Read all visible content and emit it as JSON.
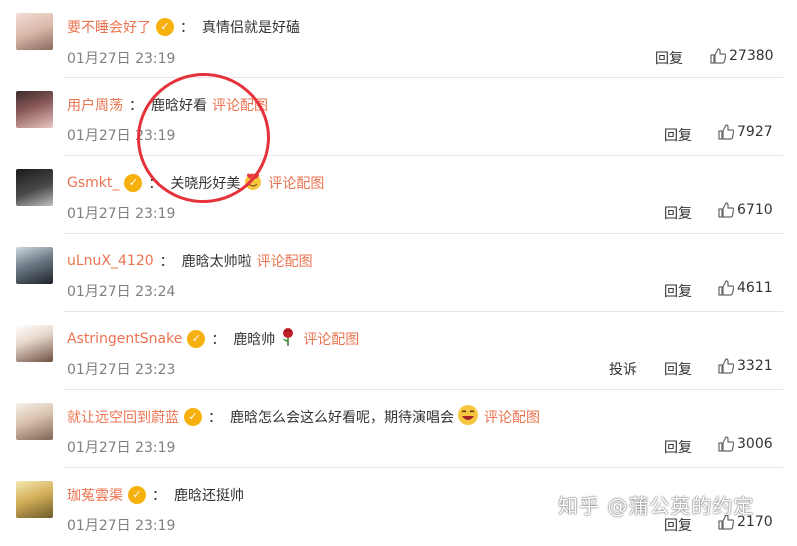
{
  "colors": {
    "username": "#eb7350",
    "pic_link": "#eb7350",
    "badge": "#f7b10f",
    "circle": "#e5323a"
  },
  "comments": [
    {
      "username": "要不睡会好了",
      "verified": true,
      "text": "真情侣就是好磕",
      "emoji": "",
      "pic_link": "",
      "time": "01月27日 23:19",
      "report": "",
      "reply": "回复",
      "likes": "27380"
    },
    {
      "username": "用户周荡",
      "verified": false,
      "text": "鹿晗好看",
      "emoji": "",
      "pic_link": "评论配图",
      "time": "01月27日 23:19",
      "report": "",
      "reply": "回复",
      "likes": "7927"
    },
    {
      "username": "Gsmkt_",
      "verified": true,
      "text": "关晓彤好美",
      "emoji": "heart-face-emoji",
      "pic_link": "评论配图",
      "time": "01月27日 23:19",
      "report": "",
      "reply": "回复",
      "likes": "6710"
    },
    {
      "username": "uLnuX_4120",
      "verified": false,
      "text": "鹿晗太帅啦",
      "emoji": "",
      "pic_link": "评论配图",
      "time": "01月27日 23:24",
      "report": "",
      "reply": "回复",
      "likes": "4611"
    },
    {
      "username": "AstringentSnake",
      "verified": true,
      "text": "鹿晗帅",
      "emoji": "rose-emoji",
      "pic_link": "评论配图",
      "time": "01月27日 23:23",
      "report": "投诉",
      "reply": "回复",
      "likes": "3321"
    },
    {
      "username": "就让远空回到蔚蓝",
      "verified": true,
      "text": "鹿晗怎么会这么好看呢，期待演唱会",
      "emoji": "laughing-emoji",
      "pic_link": "评论配图",
      "time": "01月27日 23:19",
      "report": "",
      "reply": "回复",
      "likes": "3006"
    },
    {
      "username": "珈菟雲渠",
      "verified": true,
      "text": "鹿晗还挺帅",
      "emoji": "",
      "pic_link": "",
      "time": "01月27日 23:19",
      "report": "",
      "reply": "回复",
      "likes": "2170"
    }
  ],
  "watermark": "知乎 @蒲公英的约定"
}
